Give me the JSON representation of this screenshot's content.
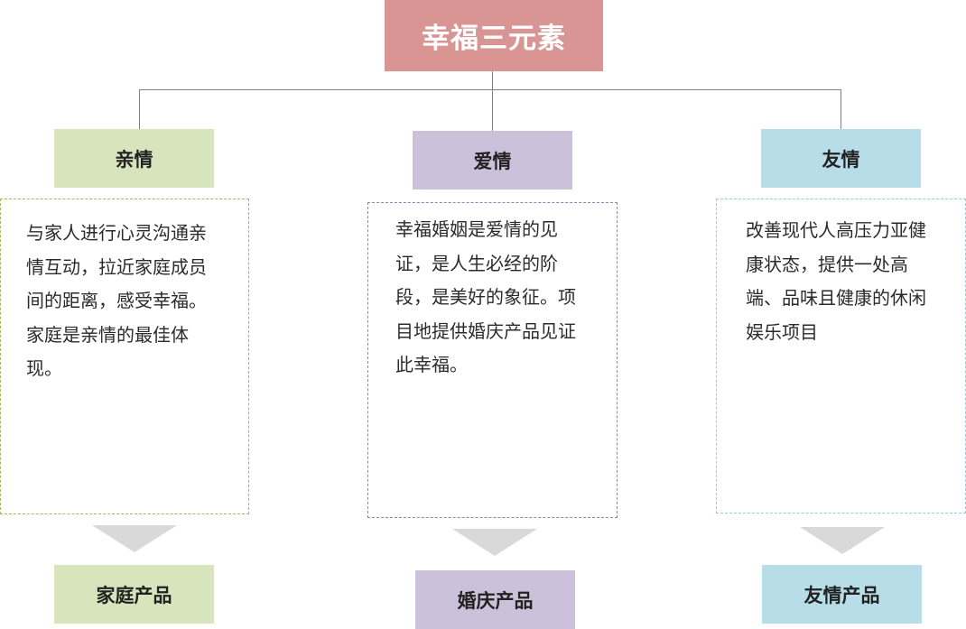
{
  "title": "幸福三元素",
  "columns": [
    {
      "heading": "亲情",
      "lines": [
        "与家人进行心灵沟通亲",
        "情互动，拉近家庭成员",
        "间的距离，感受幸福。",
        "家庭是亲情的最佳体",
        "现。"
      ],
      "product": "家庭产品",
      "color": "#d7e4bc"
    },
    {
      "heading": "爱情",
      "lines": [
        "幸福婚姻是爱情的见",
        "证，是人生必经的阶",
        "段，是美好的象征。项",
        "目地提供婚庆产品见证",
        "此幸福。"
      ],
      "product": "婚庆产品",
      "color": "#ccc1da"
    },
    {
      "heading": "友情",
      "lines": [
        "改善现代人高压力亚健",
        "康状态，提供一处高",
        "端、品味且健康的休闲",
        "娱乐项目"
      ],
      "product": "友情产品",
      "color": "#b7dee8"
    }
  ],
  "colors": {
    "title_bg": "#d99594",
    "connector": "#808080",
    "arrow": "#d9d9d9"
  }
}
